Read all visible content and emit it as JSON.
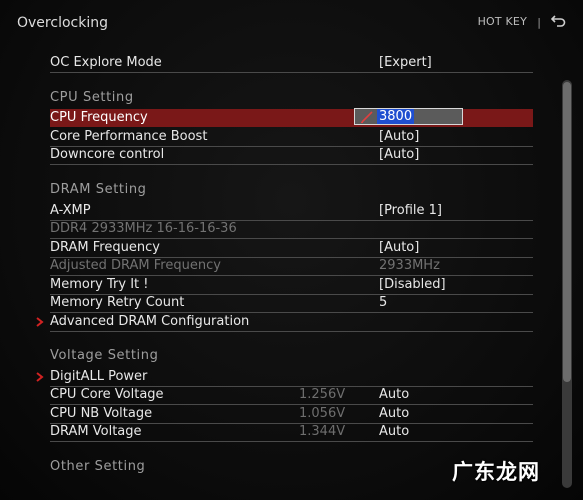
{
  "header": {
    "title": "Overclocking",
    "hotkey_label": "HOT KEY",
    "separator": "|",
    "back_icon": "back-arrow-icon"
  },
  "main": {
    "rows": [
      {
        "label": "OC Explore Mode",
        "value": "[Expert]"
      },
      {
        "section": "CPU  Setting"
      },
      {
        "label": "CPU Frequency",
        "edit_value": "3800"
      },
      {
        "label": "Core Performance Boost",
        "value": "[Auto]"
      },
      {
        "label": "Downcore control",
        "value": "[Auto]"
      },
      {
        "section": "DRAM  Setting"
      },
      {
        "label": "A-XMP",
        "value": "[Profile 1]"
      },
      {
        "label": "DDR4 2933MHz 16-16-16-36"
      },
      {
        "label": "DRAM Frequency",
        "value": "[Auto]"
      },
      {
        "label": "Adjusted DRAM Frequency",
        "value": "2933MHz"
      },
      {
        "label": "Memory Try It !",
        "value": "[Disabled]"
      },
      {
        "label": "Memory Retry Count",
        "value": "5"
      },
      {
        "label": "Advanced DRAM Configuration"
      },
      {
        "section": "Voltage  Setting"
      },
      {
        "label": "DigitALL Power"
      },
      {
        "label": "CPU Core Voltage",
        "current": "1.256V",
        "value": "Auto"
      },
      {
        "label": "CPU NB Voltage",
        "current": "1.056V",
        "value": "Auto"
      },
      {
        "label": "DRAM Voltage",
        "current": "1.344V",
        "value": "Auto"
      },
      {
        "section": "Other  Setting"
      }
    ]
  },
  "colors": {
    "selected_row": "#7a1818",
    "submenu_arrow": "#d22222",
    "edit_highlight": "#1f4fd0"
  },
  "watermark": "广东龙网"
}
